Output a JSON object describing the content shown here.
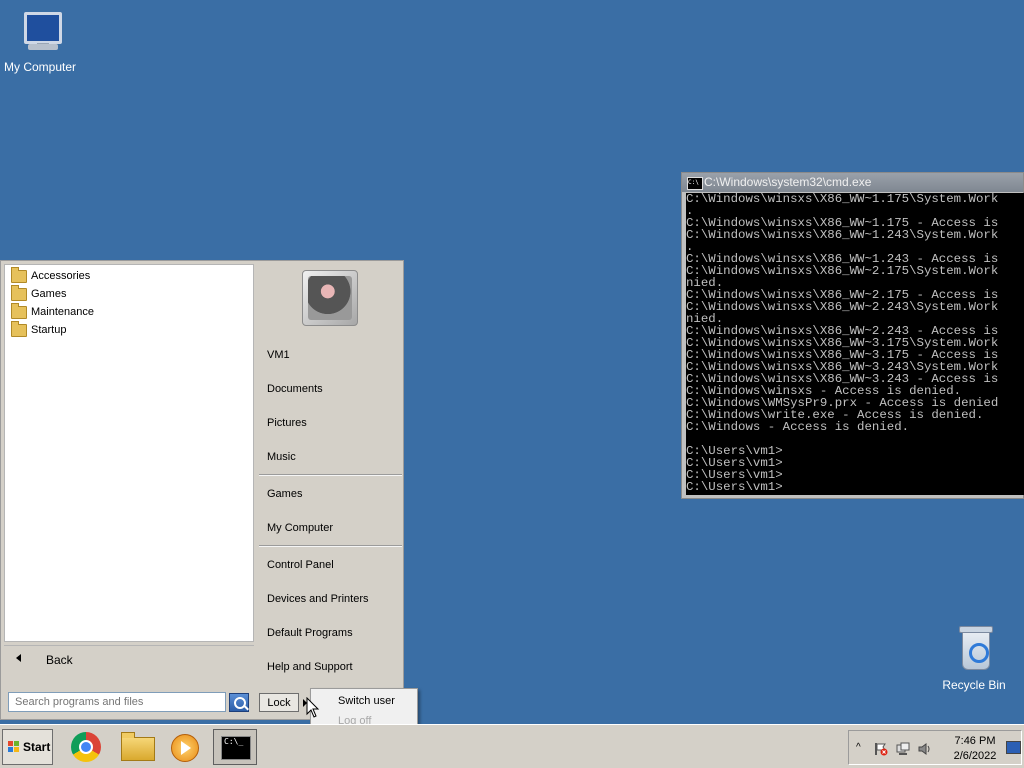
{
  "desktop": {
    "icons": [
      {
        "label": "My Computer",
        "icon": "computer-icon"
      },
      {
        "label": "Recycle Bin",
        "icon": "recycle-bin-icon"
      }
    ]
  },
  "cmd": {
    "title": "C:\\Windows\\system32\\cmd.exe",
    "lines": [
      "C:\\Windows\\winsxs\\X86_WW~1.175\\System.Work",
      ".",
      "C:\\Windows\\winsxs\\X86_WW~1.175 - Access is",
      "C:\\Windows\\winsxs\\X86_WW~1.243\\System.Work",
      ".",
      "C:\\Windows\\winsxs\\X86_WW~1.243 - Access is",
      "C:\\Windows\\winsxs\\X86_WW~2.175\\System.Work",
      "nied.",
      "C:\\Windows\\winsxs\\X86_WW~2.175 - Access is",
      "C:\\Windows\\winsxs\\X86_WW~2.243\\System.Work",
      "nied.",
      "C:\\Windows\\winsxs\\X86_WW~2.243 - Access is",
      "C:\\Windows\\winsxs\\X86_WW~3.175\\System.Work",
      "C:\\Windows\\winsxs\\X86_WW~3.175 - Access is",
      "C:\\Windows\\winsxs\\X86_WW~3.243\\System.Work",
      "C:\\Windows\\winsxs\\X86_WW~3.243 - Access is",
      "C:\\Windows\\winsxs - Access is denied.",
      "C:\\Windows\\WMSysPr9.prx - Access is denied",
      "C:\\Windows\\write.exe - Access is denied.",
      "C:\\Windows - Access is denied.",
      "",
      "C:\\Users\\vm1>",
      "C:\\Users\\vm1>",
      "C:\\Users\\vm1>",
      "C:\\Users\\vm1>"
    ]
  },
  "start_menu": {
    "programs": [
      "Accessories",
      "Games",
      "Maintenance",
      "Startup"
    ],
    "back_label": "Back",
    "search_placeholder": "Search programs and files",
    "right_items_1": [
      "VM1",
      "Documents",
      "Pictures",
      "Music"
    ],
    "right_items_2": [
      "Games",
      "My Computer"
    ],
    "right_items_3": [
      "Control Panel",
      "Devices and Printers",
      "Default Programs",
      "Help and Support"
    ],
    "lock_label": "Lock",
    "power_submenu": {
      "switch_user": "Switch user",
      "log_off": "Log off"
    }
  },
  "taskbar": {
    "start_label": "Start",
    "pinned": [
      "chrome-icon",
      "explorer-icon",
      "media-player-icon",
      "cmd-icon"
    ],
    "cmd_icon_text": "C:\\_",
    "tray": {
      "time": "7:46 PM",
      "date": "2/6/2022",
      "up_arrow": "^"
    }
  },
  "colors": {
    "desktop": "#3a6ea5",
    "menu": "#d4d0c8",
    "cmd_bg": "#000000"
  }
}
